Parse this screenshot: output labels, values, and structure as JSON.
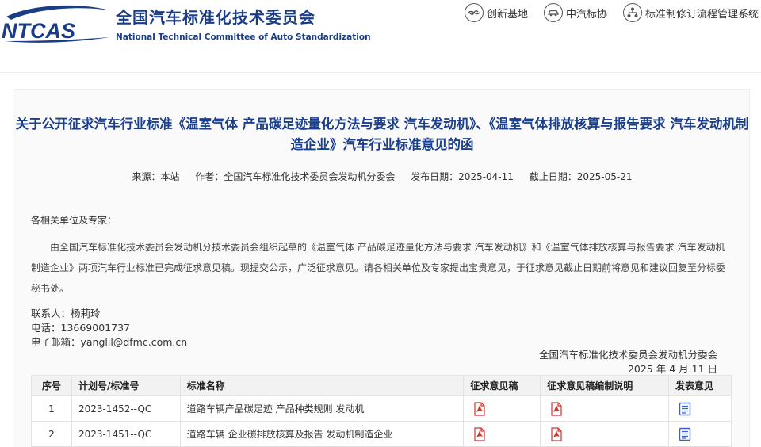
{
  "header": {
    "logo_text": "NTCAS",
    "org_name_cn": "全国汽车标准化技术委员会",
    "org_name_en": "National Technical Committee of Auto Standardization",
    "nav": [
      {
        "label": "创新基地",
        "icon": "handshake-icon"
      },
      {
        "label": "中汽标协",
        "icon": "car-icon"
      },
      {
        "label": "标准制修订流程管理系统",
        "icon": "org-chart-icon"
      }
    ]
  },
  "article": {
    "title": "关于公开征求汽车行业标准《温室气体 产品碳足迹量化方法与要求 汽车发动机》、《温室气体排放核算与报告要求 汽车发动机制造企业》汽车行业标准意见的函",
    "meta": {
      "source": "来源：本站",
      "author": "作者：全国汽车标准化技术委员会发动机分委会",
      "publish_date": "发布日期：2025-04-11",
      "deadline": "截止日期：2025-05-21"
    },
    "greeting": "各相关单位及专家：",
    "body": "由全国汽车标准化技术委员会发动机分技术委员会组织起草的《温室气体 产品碳足迹量化方法与要求 汽车发动机》和《温室气体排放核算与报告要求 汽车发动机制造企业》两项汽车行业标准已完成征求意见稿。现提交公示，广泛征求意见。请各相关单位及专家提出宝贵意见，于征求意见截止日期前将意见和建议回复至分标委秘书处。",
    "contact": {
      "person": "联系人：杨莉玲",
      "phone": "电话：13669001737",
      "email": "电子邮箱：yanglil@dfmc.com.cn"
    },
    "signature": {
      "org": "全国汽车标准化技术委员会发动机分委会",
      "date": "2025 年 4 月 11 日"
    }
  },
  "table": {
    "headers": [
      "序号",
      "计划号/标准号",
      "标准名称",
      "征求意见稿",
      "征求意见稿编制说明",
      "发表意见"
    ],
    "rows": [
      {
        "idx": "1",
        "plan": "2023-1452--QC",
        "name": "道路车辆产品碳足迹 产品种类规则 发动机"
      },
      {
        "idx": "2",
        "plan": "2023-1451--QC",
        "name": "道路车辆 企业碳排放核算及报告 发动机制造企业"
      }
    ]
  },
  "colors": {
    "brand": "#1a3d86",
    "title": "#1b3f8c",
    "pdf": "#d9322b",
    "post": "#3a5fc8"
  }
}
